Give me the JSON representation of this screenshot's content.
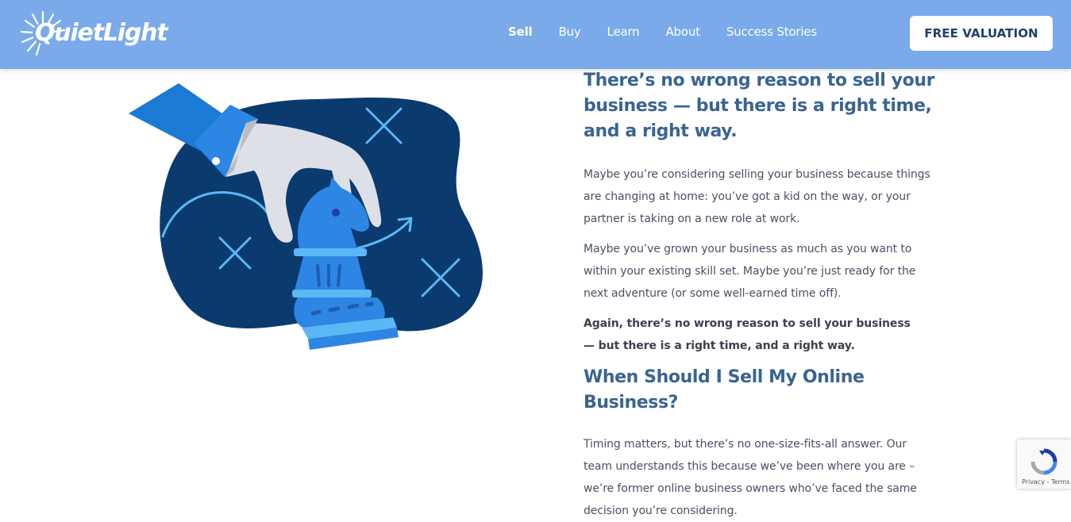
{
  "header": {
    "logo_text": "QuietLight",
    "nav": [
      {
        "label": "Sell",
        "active": true
      },
      {
        "label": "Buy",
        "active": false
      },
      {
        "label": "Learn",
        "active": false
      },
      {
        "label": "About",
        "active": false
      },
      {
        "label": "Success Stories",
        "active": false
      }
    ],
    "cta_label": "FREE VALUATION"
  },
  "content": {
    "heading1": "There’s no wrong reason to sell your business — but there is a right time, and a right way.",
    "para1": "Maybe you’re considering selling your business because things are changing at home: you’ve got a kid on the way, or your partner is taking on a new role at work.",
    "para2": "Maybe you’ve grown your business as much as you want to within your existing skill set. Maybe you’re just ready for the next adventure (or some well-earned time off).",
    "para3": "Again, there’s no wrong reason to sell your business — but there is a right time, and a right way.",
    "heading2": "When Should I Sell My Online Business?",
    "para4": "Timing matters, but there’s no one-size-fits-all answer. Our team understands this because we’ve been where you are – we’re former online business owners who’ve faced the same decision you’re considering."
  },
  "recaptcha": {
    "terms": "Privacy - Terms"
  },
  "colors": {
    "header_bg": "#7aaae9",
    "heading": "#3a6491",
    "body_text": "#4a4f63",
    "blob": "#0a3a6e",
    "accent_blue": "#2d86e3",
    "light_blue": "#5bb8f5"
  },
  "icons": {
    "logo": "sunburst-icon",
    "recaptcha": "recaptcha-icon"
  }
}
